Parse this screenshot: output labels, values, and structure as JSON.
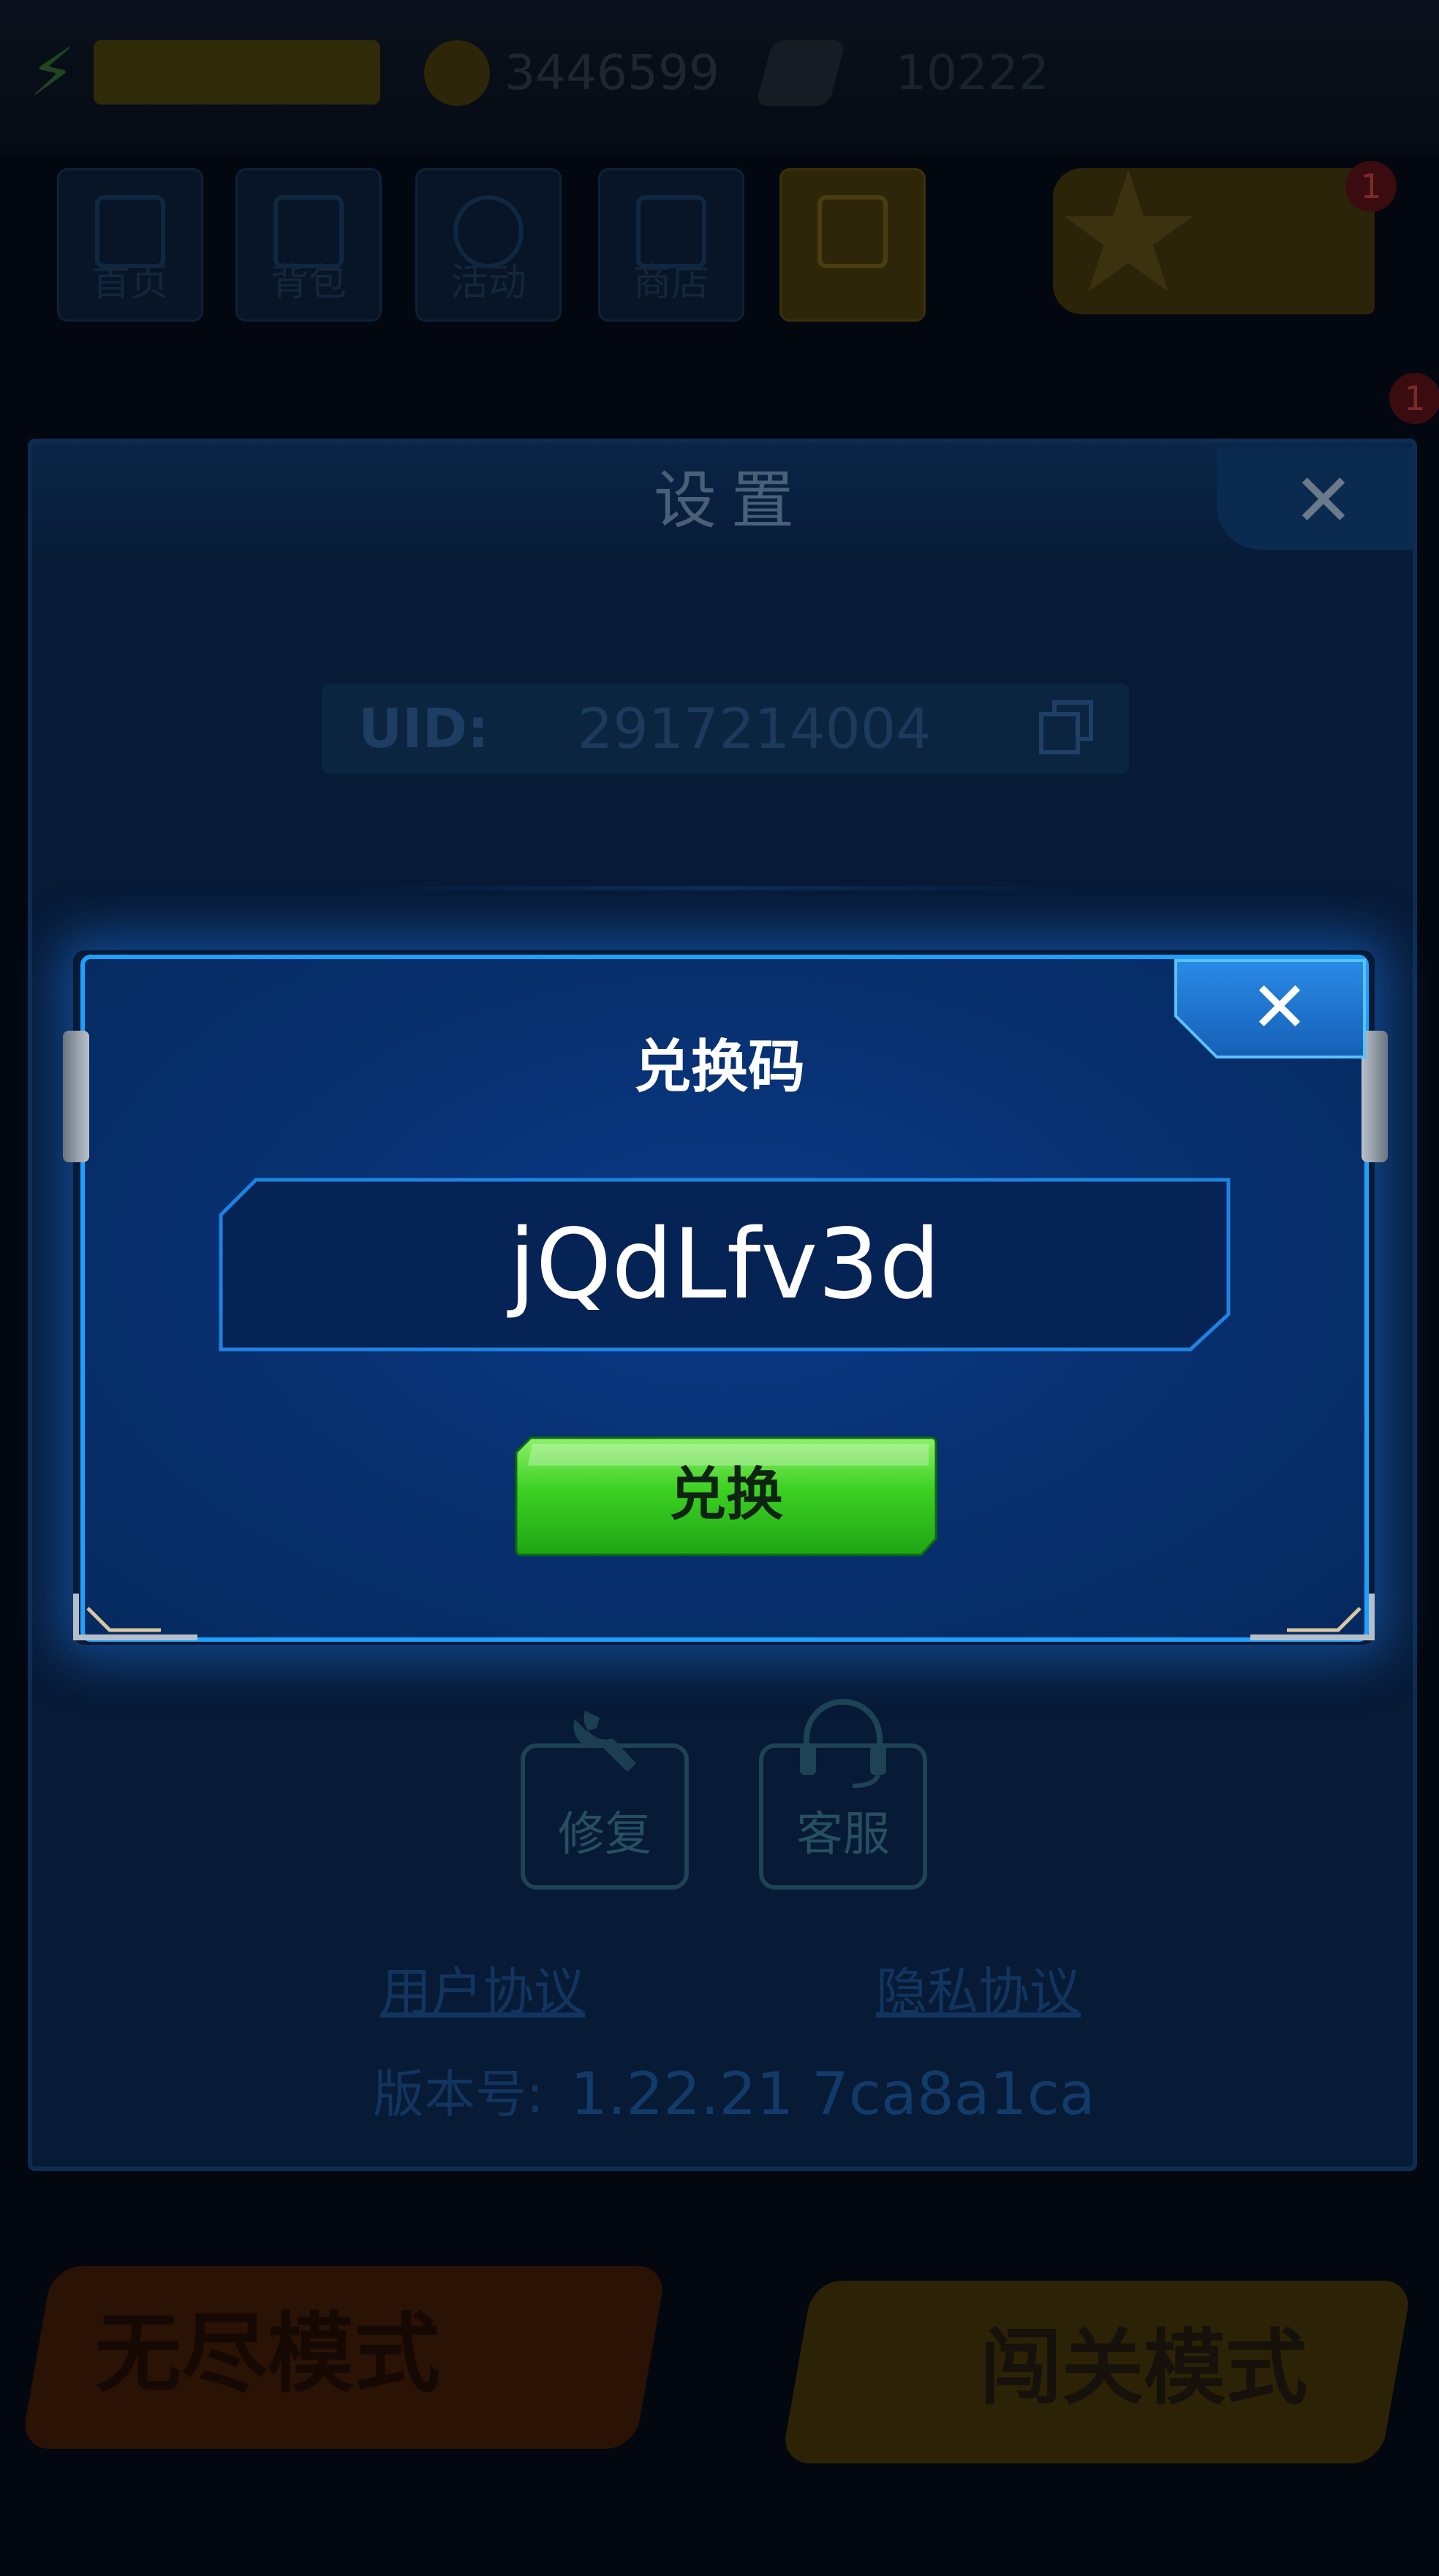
{
  "app": {
    "top_bar": {
      "coins": "3446599",
      "gems": "10222"
    },
    "nav": {
      "items": [
        {
          "label": "首页"
        },
        {
          "label": "背包"
        },
        {
          "label": "活动"
        },
        {
          "label": "商店"
        },
        {
          "label": ""
        }
      ],
      "badge_count": "1"
    },
    "modes": {
      "endless": "无尽模式",
      "stage": "闯关模式"
    }
  },
  "settings": {
    "title": "设置",
    "uid_label": "UID:",
    "uid_value": "2917214004",
    "repair_label": "修复",
    "service_label": "客服",
    "user_agreement": "用户协议",
    "privacy_agreement": "隐私协议",
    "version_label": "版本号:",
    "version_number": "1.22.21",
    "version_hash": "7ca8a1ca"
  },
  "redeem_dialog": {
    "title": "兑换码",
    "code_value": "jQdLfv3d",
    "redeem_button": "兑换",
    "close_symbol": "✕"
  },
  "colors": {
    "dialog_border": "#1da1ff",
    "dialog_bg": "#07306f",
    "button_green": "#33c41e",
    "close_blue": "#1d6fc8"
  }
}
